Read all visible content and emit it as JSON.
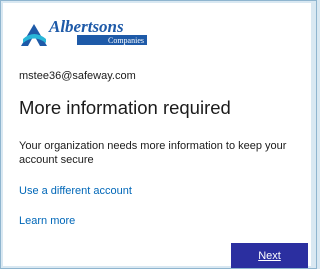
{
  "logo": {
    "name": "Albertsons",
    "subtitle": "Companies",
    "icon": "albertsons-a-logo",
    "brand_blue": "#1e5aa8",
    "accent_cyan": "#29b6d8"
  },
  "account": {
    "email": "mstee36@safeway.com"
  },
  "page": {
    "title": "More information required",
    "description": "Your organization needs more information to keep your account secure"
  },
  "links": {
    "use_different_account": "Use a different account",
    "learn_more": "Learn more"
  },
  "actions": {
    "next_label": "Next"
  },
  "colors": {
    "background": "#d9e8f2",
    "link": "#0067b8",
    "button": "#2b2fa0"
  }
}
